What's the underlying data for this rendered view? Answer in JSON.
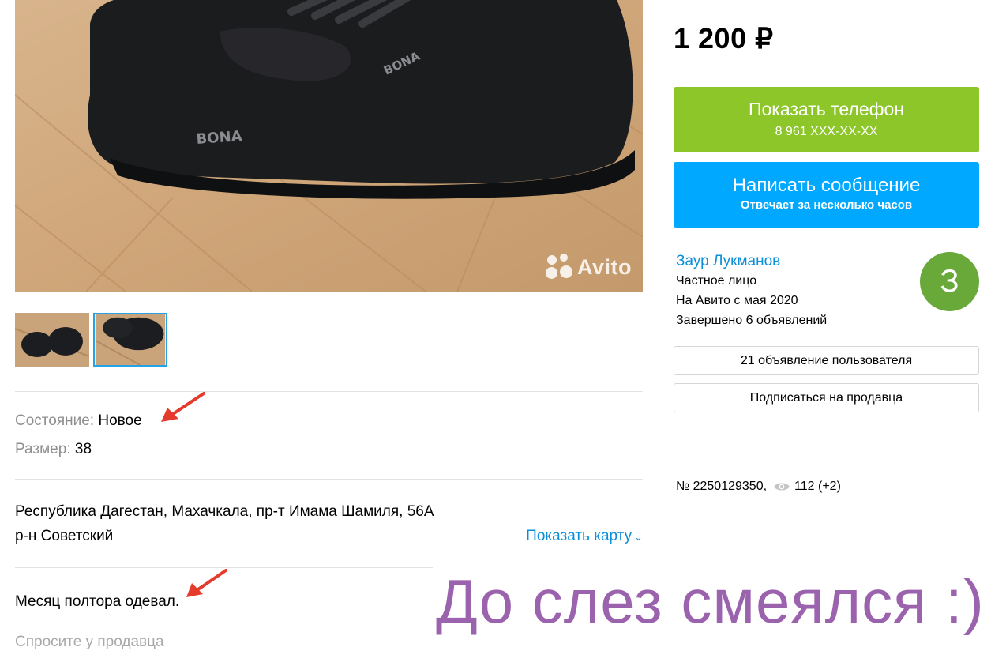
{
  "gallery": {
    "watermark": "Avito",
    "thumbnails": [
      {
        "name": "thumbnail-1",
        "selected": false
      },
      {
        "name": "thumbnail-2",
        "selected": true
      }
    ]
  },
  "params": [
    {
      "label": "Состояние:",
      "value": "Новое"
    },
    {
      "label": "Размер:",
      "value": "38"
    }
  ],
  "address": {
    "line1": "Республика Дагестан, Махачкала, пр-т Имама Шамиля, 56А",
    "line2": "р-н Советский",
    "map_link": "Показать карту"
  },
  "description": "Месяц полтора одевал.",
  "ask_seller": "Спросите у продавца",
  "price": "1 200 ₽",
  "phone_button": {
    "label": "Показать телефон",
    "number": "8 961 XXX-XX-XX"
  },
  "message_button": {
    "label": "Написать сообщение",
    "sub": "Отвечает за несколько часов"
  },
  "seller": {
    "name": "Заур Лукманов",
    "type": "Частное лицо",
    "since": "На Авито с мая 2020",
    "completed": "Завершено 6 объявлений",
    "avatar_letter": "З",
    "avatar_color": "#68a93a"
  },
  "seller_ads_button": "21 объявление пользователя",
  "subscribe_button": "Подписаться на продавца",
  "ad": {
    "number": "№ 2250129350,",
    "views": "112 (+2)"
  },
  "overlay_caption": "До слез смеялся :)",
  "colors": {
    "green": "#8cc629",
    "blue": "#00a8ff",
    "link": "#0a8ed8",
    "caption": "#9b62ad",
    "arrow": "#e53b2c"
  }
}
